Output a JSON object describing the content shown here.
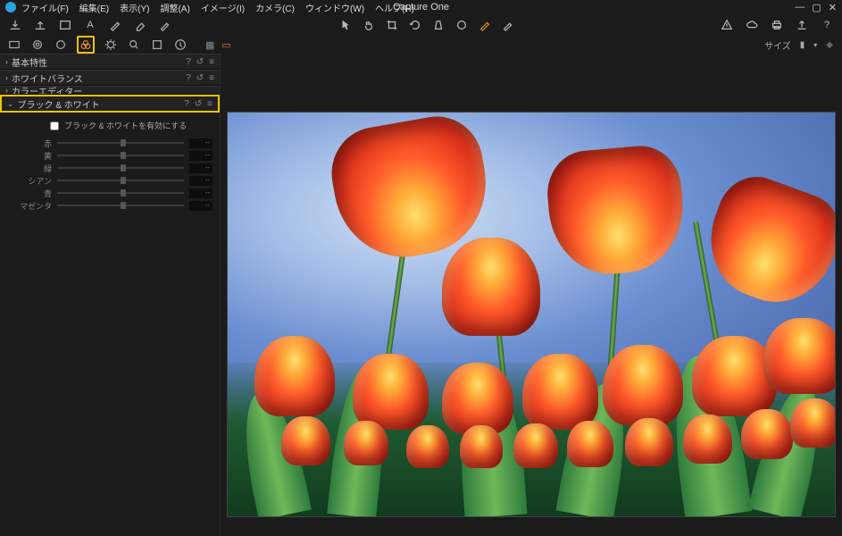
{
  "app": {
    "title": "Capture One"
  },
  "menu": {
    "file": "ファイル(F)",
    "edit": "編集(E)",
    "view": "表示(Y)",
    "adjust": "調整(A)",
    "image": "イメージ(I)",
    "camera": "カメラ(C)",
    "window": "ウィンドウ(W)",
    "help": "ヘルプ(H)"
  },
  "sidebar": {
    "panels": [
      {
        "title": "基本特性",
        "expanded": false
      },
      {
        "title": "ホワイトバランス",
        "expanded": false
      },
      {
        "title": "カラーエディター",
        "expanded": false
      },
      {
        "title": "ブラック & ホワイト",
        "expanded": true
      }
    ],
    "bw": {
      "enable_label": "ブラック & ホワイトを有効にする",
      "channels": [
        {
          "label": "赤",
          "value": "--"
        },
        {
          "label": "黄",
          "value": "--"
        },
        {
          "label": "緑",
          "value": "--"
        },
        {
          "label": "シアン",
          "value": "--"
        },
        {
          "label": "青",
          "value": "--"
        },
        {
          "label": "マゼンタ",
          "value": "--"
        }
      ]
    }
  },
  "viewer": {
    "size_label": "サイズ"
  }
}
